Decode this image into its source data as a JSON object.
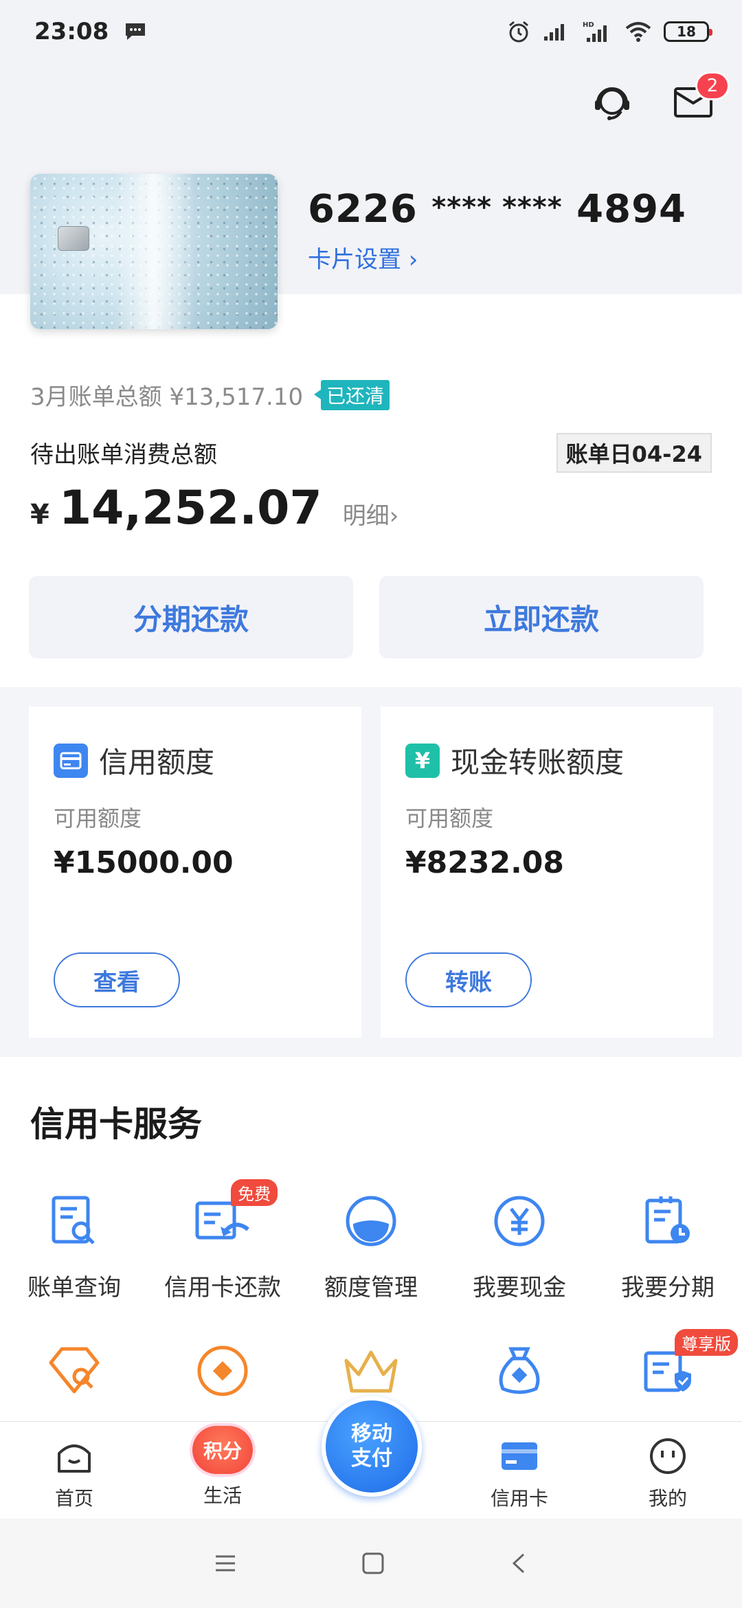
{
  "status_bar": {
    "time": "23:08",
    "battery": "18",
    "icons": [
      "message-icon",
      "alarm-icon",
      "signal-icon",
      "hd-signal-icon",
      "wifi-icon",
      "battery-icon"
    ]
  },
  "header": {
    "message_badge": "2"
  },
  "card": {
    "number_prefix": "6226",
    "number_mask": "**** ****",
    "number_suffix": "4894",
    "settings_label": "卡片设置 ›"
  },
  "bill": {
    "prev_label": "3月账单总额 ¥13,517.10",
    "paid_tag": "已还清",
    "pending_label": "待出账单消费总额",
    "bill_day": "账单日04-24",
    "currency": "¥",
    "amount": "14,252.07",
    "detail_label": "明细›",
    "installment_button": "分期还款",
    "repay_button": "立即还款"
  },
  "limits": {
    "credit": {
      "title": "信用额度",
      "sub": "可用额度",
      "value": "¥15000.00",
      "button": "查看"
    },
    "cash": {
      "title": "现金转账额度",
      "sub": "可用额度",
      "value": "¥8232.08",
      "button": "转账"
    }
  },
  "services": {
    "title": "信用卡服务",
    "row1": [
      {
        "label": "账单查询",
        "icon": "bill-query-icon"
      },
      {
        "label": "信用卡还款",
        "icon": "card-repay-icon",
        "tag": "免费"
      },
      {
        "label": "额度管理",
        "icon": "limit-manage-icon"
      },
      {
        "label": "我要现金",
        "icon": "cash-icon"
      },
      {
        "label": "我要分期",
        "icon": "installment-icon"
      }
    ],
    "row2": [
      {
        "icon": "diamond-search-icon"
      },
      {
        "icon": "orange-circle-icon"
      },
      {
        "icon": "crown-icon"
      },
      {
        "icon": "money-bag-icon"
      },
      {
        "icon": "premium-card-icon",
        "tag": "尊享版"
      }
    ]
  },
  "bottom_nav": {
    "home": "首页",
    "life": "生活",
    "life_badge": "积分",
    "pay_line1": "移动",
    "pay_line2": "支付",
    "credit": "信用卡",
    "mine": "我的"
  },
  "colors": {
    "accent_blue": "#3e79dd",
    "paid_teal": "#1fb5bd",
    "badge_red": "#f5424e",
    "orange": "#f5862b"
  }
}
